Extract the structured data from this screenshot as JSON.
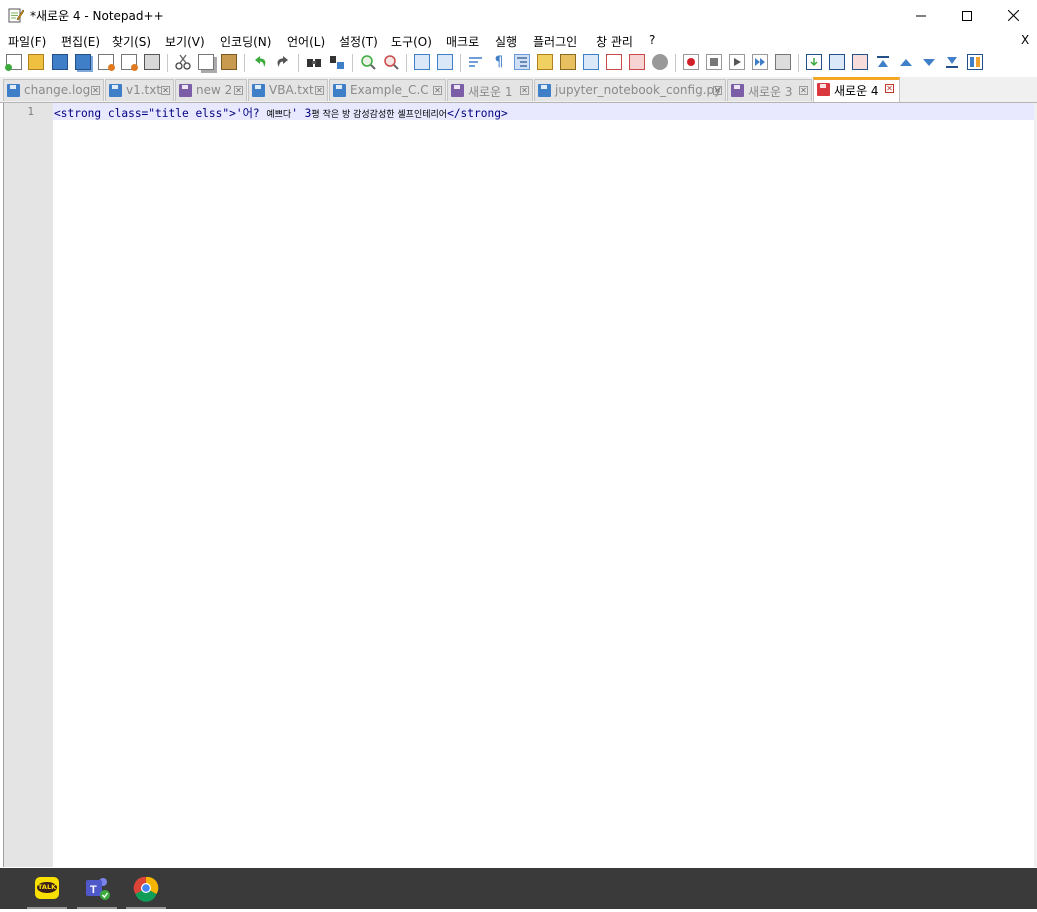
{
  "window": {
    "title": "*새로운 4 - Notepad++",
    "controls": {
      "minimize": "—",
      "maximize": "☐",
      "close": "✕"
    }
  },
  "menu": {
    "items": [
      "파일(F)",
      "편집(E)",
      "찾기(S)",
      "보기(V)",
      "인코딩(N)",
      "언어(L)",
      "설정(T)",
      "도구(O)",
      "매크로",
      "실행",
      "플러그인",
      "창 관리",
      "?"
    ],
    "close_label": "X"
  },
  "toolbar": {
    "icons": [
      "new-file",
      "open-file",
      "save",
      "save-all",
      "close",
      "close-all",
      "print",
      "cut",
      "copy",
      "paste",
      "undo",
      "redo",
      "find",
      "replace",
      "zoom-in",
      "zoom-out",
      "sync-vertical",
      "sync-horizontal",
      "word-wrap",
      "show-all-characters",
      "indent-guide",
      "user-defined-language",
      "document-map",
      "function-list",
      "folder-as-workspace",
      "monitoring",
      "start-recording",
      "stop-recording",
      "playback",
      "run-macro-multiple",
      "save-macro",
      "bookmark-next",
      "compare",
      "compare-clear",
      "first-diff",
      "previous-diff",
      "next-diff",
      "last-diff",
      "compare-settings"
    ]
  },
  "tabs": [
    {
      "label": "change.log",
      "state": "saved",
      "active": false
    },
    {
      "label": "v1.txt",
      "state": "saved",
      "active": false
    },
    {
      "label": "new 2",
      "state": "unsaved",
      "active": false
    },
    {
      "label": "VBA.txt",
      "state": "saved",
      "active": false
    },
    {
      "label": "Example_C.C",
      "state": "saved",
      "active": false
    },
    {
      "label": "새로운 1",
      "state": "unsaved",
      "active": false
    },
    {
      "label": "jupyter_notebook_config.py",
      "state": "saved",
      "active": false
    },
    {
      "label": "새로운 3",
      "state": "unsaved",
      "active": false
    },
    {
      "label": "새로운 4",
      "state": "modified",
      "active": true
    }
  ],
  "editor": {
    "lines": [
      {
        "number": "1",
        "code_open": "<strong class=\"title elss\">'어? ",
        "code_kr1": "예쁘다",
        "code_mid": "' 3",
        "code_kr2": "평 작은 방 감성감성한 셀프인테리어",
        "code_close": "</strong>"
      }
    ]
  },
  "colors": {
    "saved_tab_icon": "#3f7fc8",
    "unsaved_tab_icon": "#7b5ea7",
    "modified_tab_icon": "#d9393e",
    "active_tab_accent": "#f5a623",
    "current_line": "#e8e8ff",
    "gutter": "#e4e4e4",
    "taskbar": "#3a3a3a"
  },
  "taskbar": {
    "apps": [
      "pen-icon",
      "kakaotalk-icon",
      "teams-icon",
      "chrome-icon"
    ],
    "kakaotalk_label": "TALK"
  }
}
